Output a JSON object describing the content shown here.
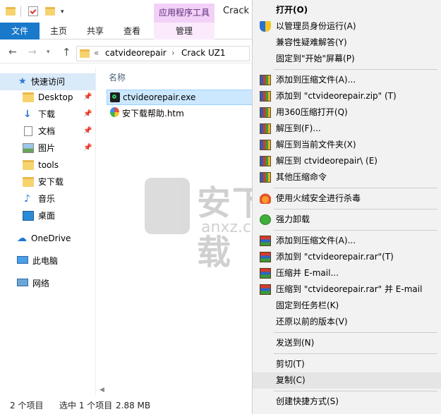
{
  "titlebar": {
    "context_tab_group": "应用程序工具",
    "window_title": "Crack"
  },
  "ribbon": {
    "tabs": [
      {
        "label": "文件"
      },
      {
        "label": "主页"
      },
      {
        "label": "共享"
      },
      {
        "label": "查看"
      },
      {
        "label": "管理"
      }
    ]
  },
  "address": {
    "overflow": "«",
    "crumbs": [
      "catvideorepair",
      "Crack UZ1"
    ]
  },
  "nav": {
    "quick_access": "快速访问",
    "items": [
      {
        "label": "Desktop",
        "pinned": true
      },
      {
        "label": "下载",
        "pinned": true
      },
      {
        "label": "文档",
        "pinned": true
      },
      {
        "label": "图片",
        "pinned": true
      },
      {
        "label": "tools",
        "pinned": false
      },
      {
        "label": "安下载",
        "pinned": false
      },
      {
        "label": "音乐",
        "pinned": false
      },
      {
        "label": "桌面",
        "pinned": false
      }
    ],
    "onedrive": "OneDrive",
    "this_pc": "此电脑",
    "network": "网络"
  },
  "files": {
    "column_name": "名称",
    "items": [
      {
        "name": "ctvideorepair.exe",
        "selected": true
      },
      {
        "name": "安下载帮助.htm",
        "selected": false
      }
    ]
  },
  "status": {
    "count": "2 个项目",
    "selection": "选中 1 个项目",
    "size": "2.88 MB"
  },
  "context_menu": {
    "items": [
      {
        "label": "打开(O)",
        "bold": true,
        "icon": "none"
      },
      {
        "label": "以管理员身份运行(A)",
        "icon": "uac-shield-icon"
      },
      {
        "label": "兼容性疑难解答(Y)",
        "icon": "none"
      },
      {
        "label": "固定到\"开始\"屏幕(P)",
        "icon": "none"
      },
      {
        "label": "添加到压缩文件(A)...",
        "icon": "360zip-icon"
      },
      {
        "label": "添加到 \"ctvideorepair.zip\" (T)",
        "icon": "360zip-icon"
      },
      {
        "label": "用360压缩打开(Q)",
        "icon": "360zip-icon"
      },
      {
        "label": "解压到(F)...",
        "icon": "360zip-icon"
      },
      {
        "label": "解压到当前文件夹(X)",
        "icon": "360zip-icon"
      },
      {
        "label": "解压到 ctvideorepair\\ (E)",
        "icon": "360zip-icon"
      },
      {
        "label": "其他压缩命令",
        "icon": "360zip-icon"
      },
      {
        "label": "使用火绒安全进行杀毒",
        "icon": "huorong-icon"
      },
      {
        "label": "强力卸载",
        "icon": "uninstall-icon"
      },
      {
        "label": "添加到压缩文件(A)...",
        "icon": "winrar-icon"
      },
      {
        "label": "添加到 \"ctvideorepair.rar\"(T)",
        "icon": "winrar-icon"
      },
      {
        "label": "压缩并 E-mail...",
        "icon": "winrar-icon"
      },
      {
        "label": "压缩到 \"ctvideorepair.rar\" 并 E-mail",
        "icon": "winrar-icon"
      },
      {
        "label": "固定到任务栏(K)",
        "icon": "none"
      },
      {
        "label": "还原以前的版本(V)",
        "icon": "none"
      },
      {
        "label": "发送到(N)",
        "icon": "none"
      },
      {
        "label": "剪切(T)",
        "icon": "none"
      },
      {
        "label": "复制(C)",
        "icon": "none",
        "hovered": true
      },
      {
        "label": "创建快捷方式(S)",
        "icon": "none"
      }
    ]
  },
  "watermark": {
    "brand": "安下载",
    "domain": "anxz.com"
  },
  "colors": {
    "file_tab": "#1979ca",
    "context_tab": "#f3d1f7",
    "selection": "#cce8ff",
    "quick_access_bg": "#d9eaf9",
    "menu_bg": "#f2f2f2",
    "menu_hover": "#e5e5e5"
  }
}
